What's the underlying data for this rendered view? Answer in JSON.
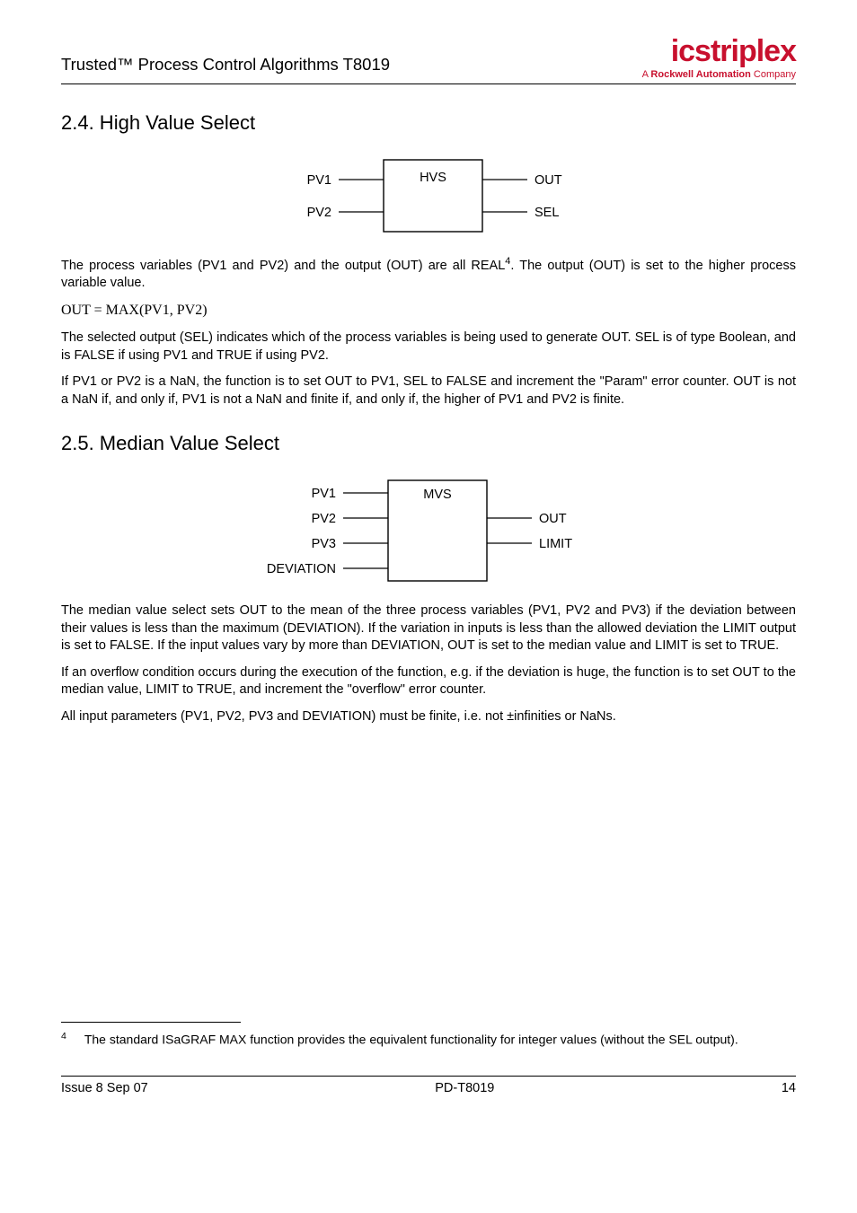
{
  "header": {
    "title_line": "Trusted™ Process Control Algorithms T8019",
    "logo_main_a": "ics",
    "logo_main_b": "triplex",
    "logo_sub_prefix": "A ",
    "logo_sub_bold": "Rockwell Automation",
    "logo_sub_suffix": " Company"
  },
  "section24": {
    "heading": "2.4. High Value Select",
    "diagram": {
      "box_label": "HVS",
      "in1": "PV1",
      "in2": "PV2",
      "out1": "OUT",
      "out2": "SEL"
    },
    "para1_a": "The process variables (PV1 and PV2) and the output (OUT) are all REAL",
    "para1_sup": "4",
    "para1_b": ".  The output (OUT) is set to the higher process variable value.",
    "formula": "OUT = MAX(PV1, PV2)",
    "para2": "The selected output (SEL) indicates which of the process variables is being used to generate OUT.  SEL is of type Boolean, and is FALSE if using PV1 and TRUE if using PV2.",
    "para3": "If PV1 or PV2 is a NaN, the function is to set OUT to PV1, SEL to FALSE and increment the \"Param\" error counter.  OUT is not a NaN if, and only if, PV1 is not a NaN and finite if, and only if, the higher of PV1 and PV2 is finite."
  },
  "section25": {
    "heading": "2.5. Median Value Select",
    "diagram": {
      "box_label": "MVS",
      "in1": "PV1",
      "in2": "PV2",
      "in3": "PV3",
      "in4": "DEVIATION",
      "out1": "OUT",
      "out2": "LIMIT"
    },
    "para1": "The median value select sets OUT to the mean of the three process variables (PV1, PV2 and PV3) if the deviation between their values is less than the maximum (DEVIATION).  If the variation in inputs is less than the allowed deviation the LIMIT output is set to FALSE.  If the input values vary by more than DEVIATION, OUT is set to the median value and LIMIT is set to TRUE.",
    "para2": "If an overflow condition occurs during the execution of the function, e.g. if the deviation is huge, the function is to set OUT to the median value, LIMIT to TRUE, and increment the \"overflow\" error counter.",
    "para3": "All input parameters (PV1, PV2, PV3 and DEVIATION) must be finite, i.e. not ±infinities or NaNs."
  },
  "footnote": {
    "num": "4",
    "text": "The standard ISaGRAF MAX function provides the equivalent functionality for integer values (without the SEL output)."
  },
  "footer": {
    "left": "Issue 8 Sep 07",
    "center": "PD-T8019",
    "right": "14"
  }
}
